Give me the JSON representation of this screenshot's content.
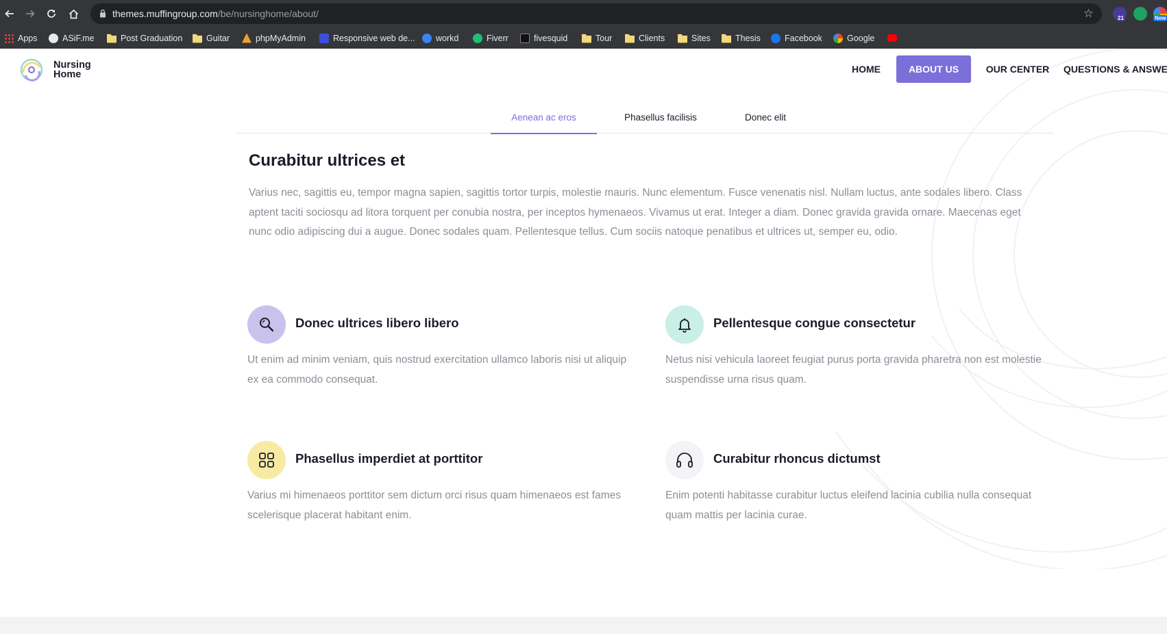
{
  "browser": {
    "url_host": "themes.muffingroup.com",
    "url_path": "/be/nursinghome/about/",
    "extension_badge_count": "21",
    "extension_new_label": "New",
    "bookmarks": [
      {
        "label": "Apps",
        "icon": "apps-grid-icon"
      },
      {
        "label": "ASiF.me",
        "icon": "globe-icon"
      },
      {
        "label": "Post Graduation",
        "icon": "folder-icon"
      },
      {
        "label": "Guitar",
        "icon": "folder-icon"
      },
      {
        "label": "phpMyAdmin",
        "icon": "phpmyadmin-icon"
      },
      {
        "label": "Responsive web de...",
        "icon": "w-icon"
      },
      {
        "label": "workd",
        "icon": "workd-icon"
      },
      {
        "label": "Fiverr",
        "icon": "fiverr-icon"
      },
      {
        "label": "fivesquid",
        "icon": "f-icon"
      },
      {
        "label": "Tour",
        "icon": "folder-icon"
      },
      {
        "label": "Clients",
        "icon": "folder-icon"
      },
      {
        "label": "Sites",
        "icon": "folder-icon"
      },
      {
        "label": "Thesis",
        "icon": "folder-icon"
      },
      {
        "label": "Facebook",
        "icon": "facebook-icon"
      },
      {
        "label": "Google",
        "icon": "google-icon"
      },
      {
        "label": "",
        "icon": "youtube-icon"
      }
    ]
  },
  "site": {
    "logo_line1": "Nursing",
    "logo_line2": "Home",
    "accent_color": "#7b6fd9",
    "nav": [
      {
        "label": "HOME",
        "active": false
      },
      {
        "label": "ABOUT US",
        "active": true
      },
      {
        "label": "OUR CENTER",
        "active": false
      },
      {
        "label": "QUESTIONS & ANSWERS",
        "active": false
      }
    ]
  },
  "tabs": [
    {
      "label": "Aenean ac eros",
      "active": true
    },
    {
      "label": "Phasellus facilisis",
      "active": false
    },
    {
      "label": "Donec elit",
      "active": false
    }
  ],
  "intro": {
    "title": "Curabitur ultrices et",
    "text": "Varius nec, sagittis eu, tempor magna sapien, sagittis tortor turpis, molestie mauris. Nunc elementum. Fusce venenatis nisl. Nullam luctus, ante sodales libero. Class aptent taciti sociosqu ad litora torquent per conubia nostra, per inceptos hymenaeos. Vivamus ut erat. Integer a diam. Donec gravida gravida ornare. Maecenas eget nunc odio adipiscing dui a augue. Donec sodales quam. Pellentesque tellus. Cum sociis natoque penatibus et ultrices ut, semper eu, odio."
  },
  "features": [
    {
      "icon": "search-icon",
      "color": "#c9c2ec",
      "title": "Donec ultrices libero libero",
      "text": "Ut enim ad minim veniam, quis nostrud exercitation ullamco laboris nisi ut aliquip ex ea commodo consequat."
    },
    {
      "icon": "bell-icon",
      "color": "#c9efe7",
      "title": "Pellentesque congue consectetur",
      "text": "Netus nisi vehicula laoreet feugiat purus porta gravida pharetra non est molestie suspendisse urna risus quam."
    },
    {
      "icon": "grid-icon",
      "color": "#f7eba4",
      "title": "Phasellus imperdiet at porttitor",
      "text": "Varius mi himenaeos porttitor sem dictum orci risus quam himenaeos est fames scelerisque placerat habitant enim."
    },
    {
      "icon": "headphones-icon",
      "color": "#f4f4f6",
      "title": "Curabitur rhoncus dictumst",
      "text": "Enim potenti habitasse curabitur luctus eleifend lacinia cubilia nulla consequat quam mattis per lacinia curae."
    }
  ]
}
